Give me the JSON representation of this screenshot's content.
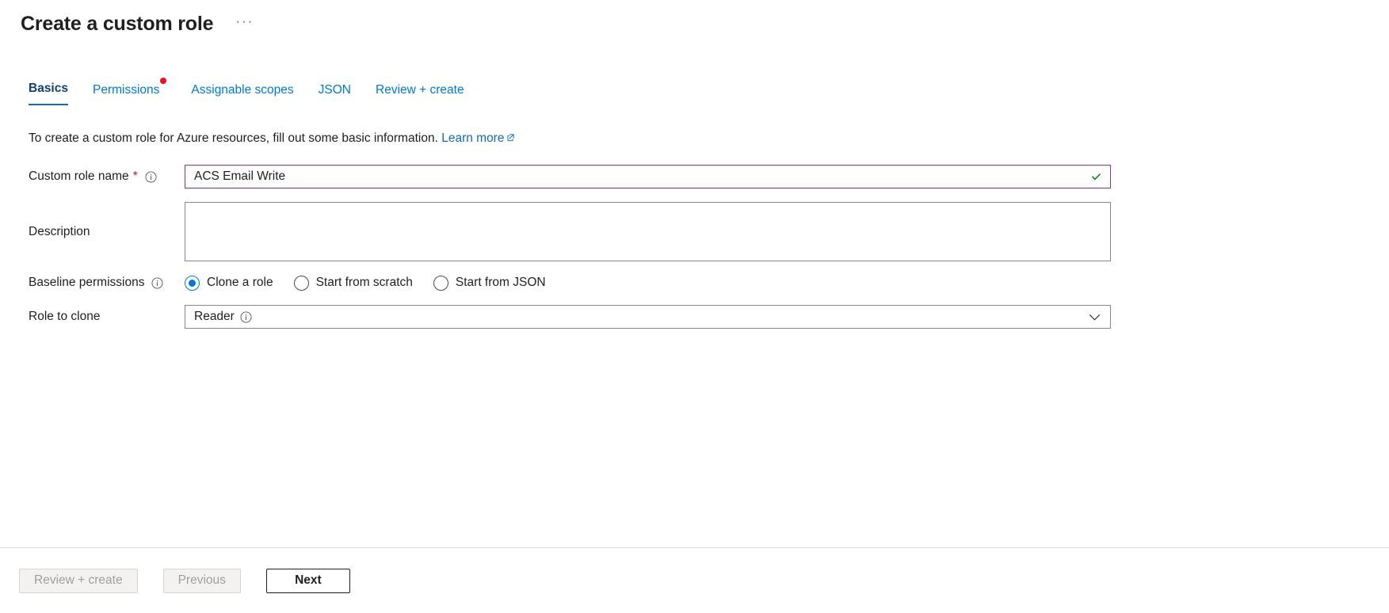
{
  "header": {
    "title": "Create a custom role",
    "more_label": "···"
  },
  "tabs": [
    {
      "label": "Basics",
      "selected": true,
      "dot": false
    },
    {
      "label": "Permissions",
      "selected": false,
      "dot": true
    },
    {
      "label": "Assignable scopes",
      "selected": false,
      "dot": false
    },
    {
      "label": "JSON",
      "selected": false,
      "dot": false
    },
    {
      "label": "Review + create",
      "selected": false,
      "dot": false
    }
  ],
  "intro": {
    "text": "To create a custom role for Azure resources, fill out some basic information.",
    "link_label": "Learn more",
    "link_icon": "external-link-icon"
  },
  "form": {
    "role_name": {
      "label": "Custom role name",
      "required_marker": "*",
      "info_icon": "info-icon",
      "value": "ACS Email Write",
      "placeholder": "",
      "validation_icon": "checkmark-icon",
      "border_color": "#8a2f93"
    },
    "description": {
      "label": "Description",
      "value": "",
      "placeholder": ""
    },
    "baseline_permissions": {
      "label": "Baseline permissions",
      "info_icon": "info-icon",
      "selected": "Clone a role",
      "options": [
        {
          "label": "Clone a role",
          "checked": true
        },
        {
          "label": "Start from scratch",
          "checked": false
        },
        {
          "label": "Start from JSON",
          "checked": false
        }
      ]
    },
    "role_to_clone": {
      "label": "Role to clone",
      "value": "Reader",
      "info_icon": "info-icon",
      "chevron_icon": "chevron-down-icon"
    }
  },
  "footer": {
    "review_create_label": "Review + create",
    "previous_label": "Previous",
    "next_label": "Next"
  },
  "colors": {
    "accent": "#0078d4",
    "link": "#0f6cbd",
    "required": "#a4262c",
    "dot": "#e81123",
    "valid_border": "#8a2f93",
    "valid_check": "#107c10"
  }
}
